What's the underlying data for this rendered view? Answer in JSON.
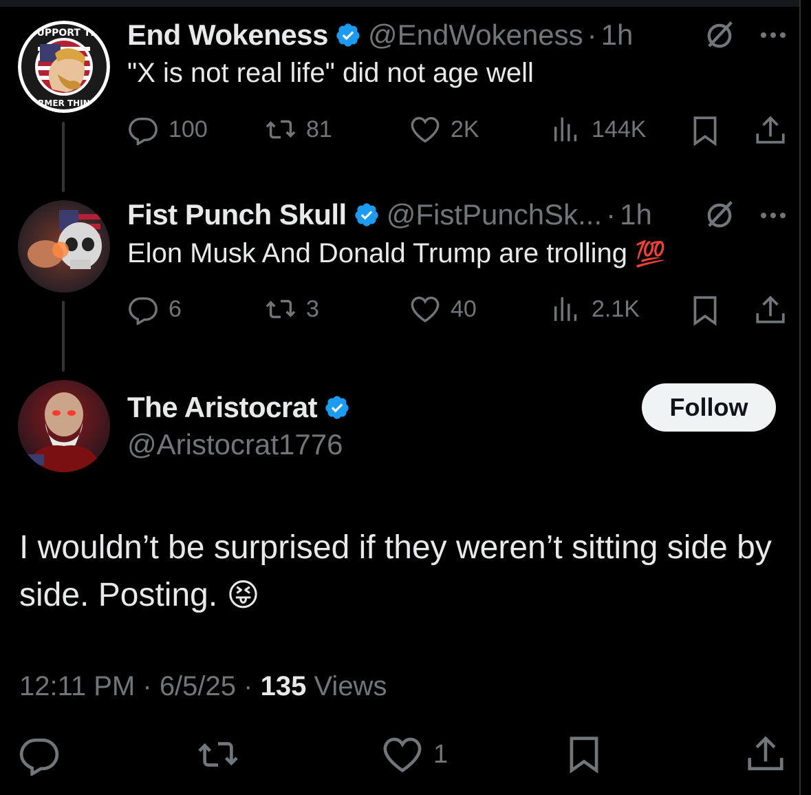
{
  "posts": [
    {
      "name": "End Wokeness",
      "handle": "@EndWokeness",
      "separator": "·",
      "time": "1h",
      "avatar": {
        "top_text": "I SUPPORT THE",
        "bottom_text": "FORMER THINGS"
      },
      "text": "\"X is not real life\" did not age well",
      "stats": {
        "replies": "100",
        "reposts": "81",
        "likes": "2K",
        "views": "144K"
      }
    },
    {
      "name": "Fist Punch Skull",
      "handle": "@FistPunchSk...",
      "separator": "·",
      "time": "1h",
      "text": "Elon Musk And Donald Trump are trolling",
      "emoji": "💯",
      "stats": {
        "replies": "6",
        "reposts": "3",
        "likes": "40",
        "views": "2.1K"
      }
    }
  ],
  "main": {
    "name": "The Aristocrat",
    "handle": "@Aristocrat1776",
    "follow_label": "Follow",
    "text": "I wouldn’t be surprised if they weren’t sitting side by side. Posting.",
    "emoji": "😝",
    "time": "12:11 PM",
    "date": "6/5/25",
    "views_count": "135",
    "views_label": "Views",
    "likes": "1"
  },
  "colors": {
    "verified": "#1d9bf0",
    "muted": "#71767b",
    "text": "#e7e9ea",
    "background": "#000000"
  },
  "icons": [
    "reply-icon",
    "repost-icon",
    "like-icon",
    "views-icon",
    "bookmark-icon",
    "share-icon",
    "grok-icon",
    "more-icon",
    "verified-badge-icon"
  ]
}
